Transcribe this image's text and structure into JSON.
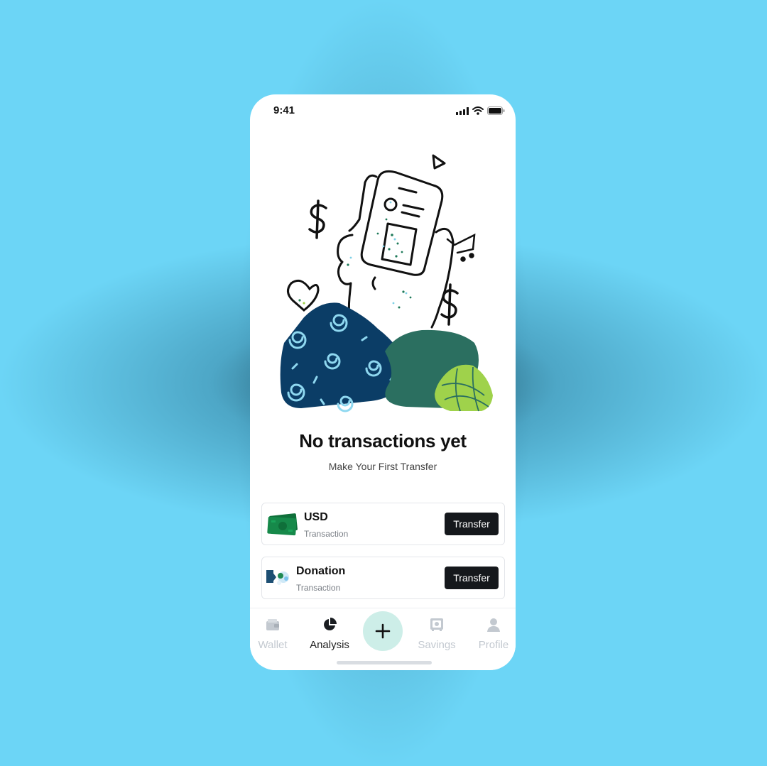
{
  "status_bar": {
    "time": "9:41"
  },
  "empty_state": {
    "title": "No transactions yet",
    "subtitle": "Make Your First Transfer"
  },
  "transactions": [
    {
      "title": "USD",
      "subtitle": "Transaction",
      "button": "Transfer",
      "icon": "cash-icon"
    },
    {
      "title": "Donation",
      "subtitle": "Transaction",
      "button": "Transfer",
      "icon": "donation-icon"
    }
  ],
  "tab_bar": {
    "items": [
      {
        "label": "Wallet",
        "icon": "wallet-icon",
        "active": false
      },
      {
        "label": "Analysis",
        "icon": "pie-chart-icon",
        "active": true
      },
      {
        "label": "",
        "icon": "plus-icon",
        "active": false
      },
      {
        "label": "Savings",
        "icon": "safe-icon",
        "active": false
      },
      {
        "label": "Profile",
        "icon": "user-icon",
        "active": false
      }
    ]
  },
  "colors": {
    "background": "#6cd5f6",
    "primary_button": "#15181c",
    "add_button": "#cdeee8",
    "illustration_navy": "#0b3d66",
    "illustration_green": "#2b6f60",
    "illustration_lime": "#9fd24b"
  }
}
